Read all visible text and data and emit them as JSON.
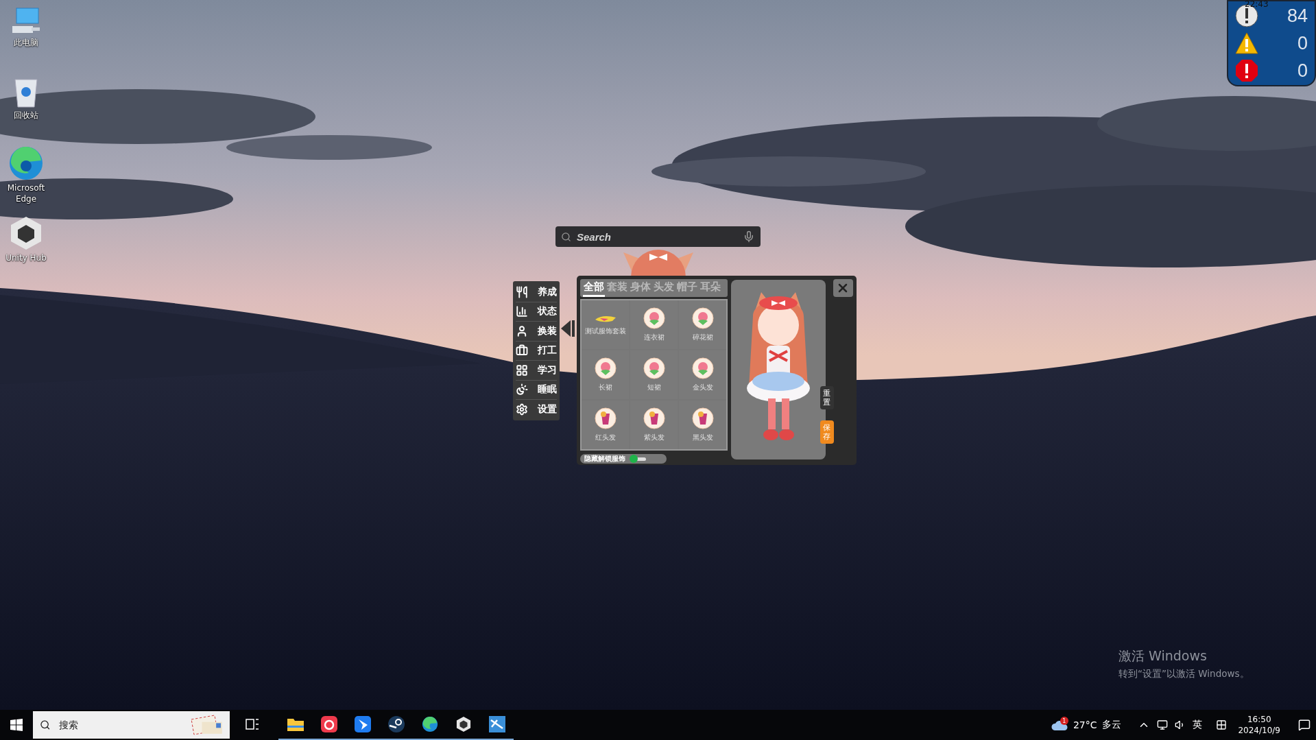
{
  "desktop_icons": [
    {
      "label": "此电脑",
      "kind": "computer"
    },
    {
      "label": "回收站",
      "kind": "recycle"
    },
    {
      "label": "Microsoft Edge",
      "kind": "edge"
    },
    {
      "label": "Unity Hub",
      "kind": "unity"
    }
  ],
  "status_widget": {
    "time": "22:43",
    "rows": [
      {
        "kind": "info",
        "count": "84"
      },
      {
        "kind": "warning",
        "count": "0"
      },
      {
        "kind": "error",
        "count": "0"
      }
    ]
  },
  "search": {
    "placeholder": "Search"
  },
  "side_menu": [
    {
      "label": "养成",
      "kind": "food"
    },
    {
      "label": "状态",
      "kind": "chart"
    },
    {
      "label": "换装",
      "kind": "person"
    },
    {
      "label": "打工",
      "kind": "work"
    },
    {
      "label": "学习",
      "kind": "study"
    },
    {
      "label": "睡眠",
      "kind": "sleep"
    },
    {
      "label": "设置",
      "kind": "settings"
    }
  ],
  "wardrobe": {
    "tabs": [
      {
        "label": "全部",
        "selected": true
      },
      {
        "label": "套装",
        "selected": false
      },
      {
        "label": "身体",
        "selected": false
      },
      {
        "label": "头发",
        "selected": false
      },
      {
        "label": "帽子",
        "selected": false
      },
      {
        "label": "耳朵",
        "selected": false
      }
    ],
    "items": [
      {
        "label": "测试服饰套装",
        "kind": "suit"
      },
      {
        "label": "连衣裙",
        "kind": "peach"
      },
      {
        "label": "碎花裙",
        "kind": "peach"
      },
      {
        "label": "长裙",
        "kind": "peach"
      },
      {
        "label": "短裙",
        "kind": "peach"
      },
      {
        "label": "金头发",
        "kind": "peach"
      },
      {
        "label": "红头发",
        "kind": "drink"
      },
      {
        "label": "紫头发",
        "kind": "drink"
      },
      {
        "label": "黑头发",
        "kind": "drink"
      }
    ],
    "hide_toggle": {
      "label": "隐藏解锁服饰",
      "on": true
    },
    "reset_label": "重置",
    "save_label": "保存"
  },
  "activation": {
    "title": "激活 Windows",
    "subtitle": "转到“设置”以激活 Windows。"
  },
  "taskbar": {
    "search_placeholder": "搜索",
    "apps": [
      {
        "kind": "explorer",
        "running": true
      },
      {
        "kind": "music",
        "running": true
      },
      {
        "kind": "feishu",
        "running": true
      },
      {
        "kind": "steam",
        "running": true
      },
      {
        "kind": "edge",
        "running": true
      },
      {
        "kind": "unity",
        "running": true
      },
      {
        "kind": "studio",
        "running": true
      }
    ],
    "weather": {
      "badge": "1",
      "temperature": "27°C",
      "condition": "多云"
    },
    "ime": "英",
    "time": "16:50",
    "date": "2024/10/9"
  }
}
